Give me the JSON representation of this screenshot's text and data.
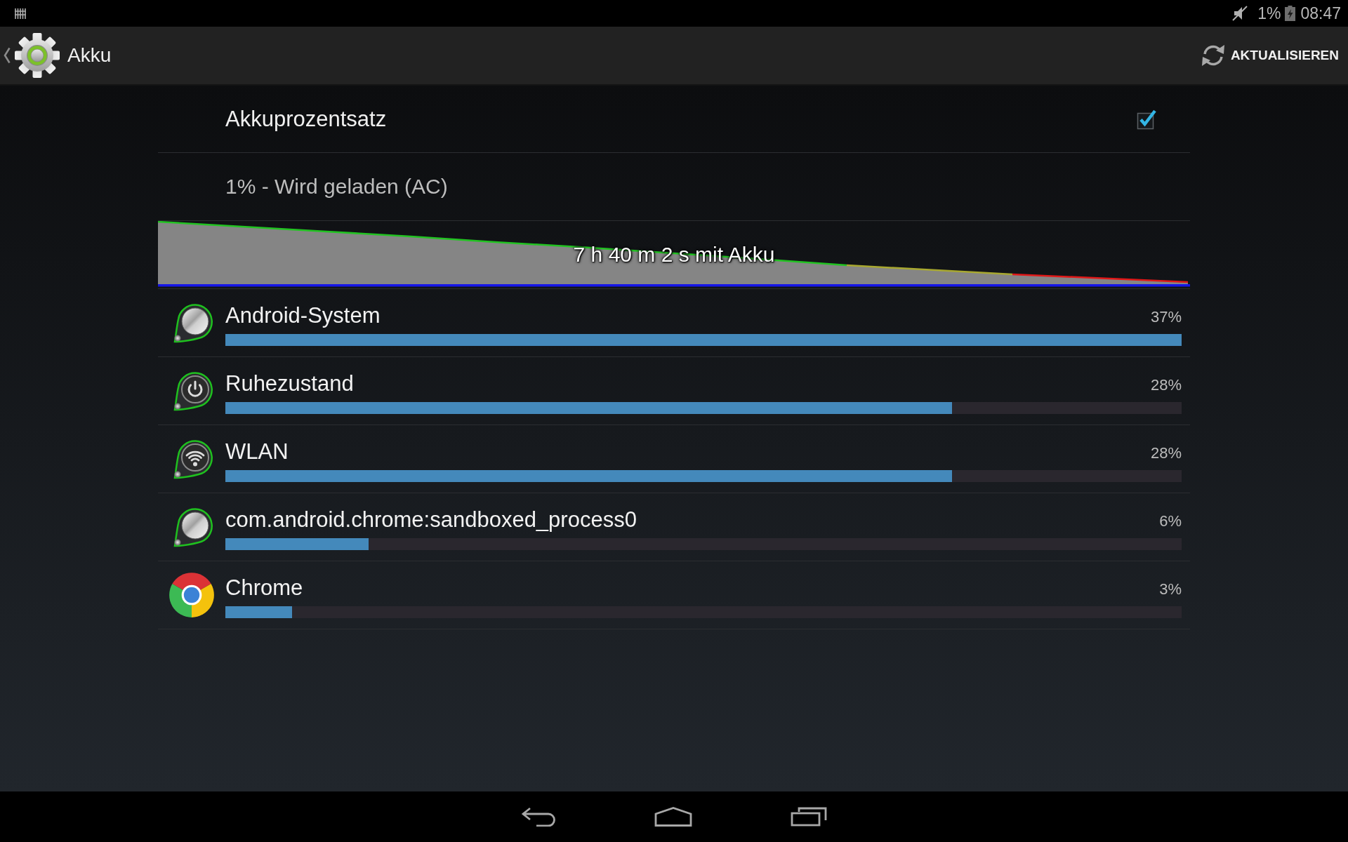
{
  "status_bar": {
    "battery": "1%",
    "time": "08:47"
  },
  "action_bar": {
    "title": "Akku",
    "action": "AKTUALISIEREN"
  },
  "percentage_setting": {
    "label": "Akkuprozentsatz",
    "checked": true
  },
  "charging_status": "1% - Wird geladen (AC)",
  "history": {
    "label": "7 h 40 m 2 s mit Akku"
  },
  "usage": [
    {
      "kind": "system",
      "name": "Android-System",
      "percent": "37%",
      "level": 1
    },
    {
      "kind": "sleep",
      "name": "Ruhezustand",
      "percent": "28%",
      "level": 0.76
    },
    {
      "kind": "wifi",
      "name": "WLAN",
      "percent": "28%",
      "level": 0.76
    },
    {
      "kind": "system",
      "name": "com.android.chrome:sandboxed_process0",
      "percent": "6%",
      "level": 0.15
    },
    {
      "kind": "chrome",
      "name": "Chrome",
      "percent": "3%",
      "level": 0.07
    }
  ]
}
